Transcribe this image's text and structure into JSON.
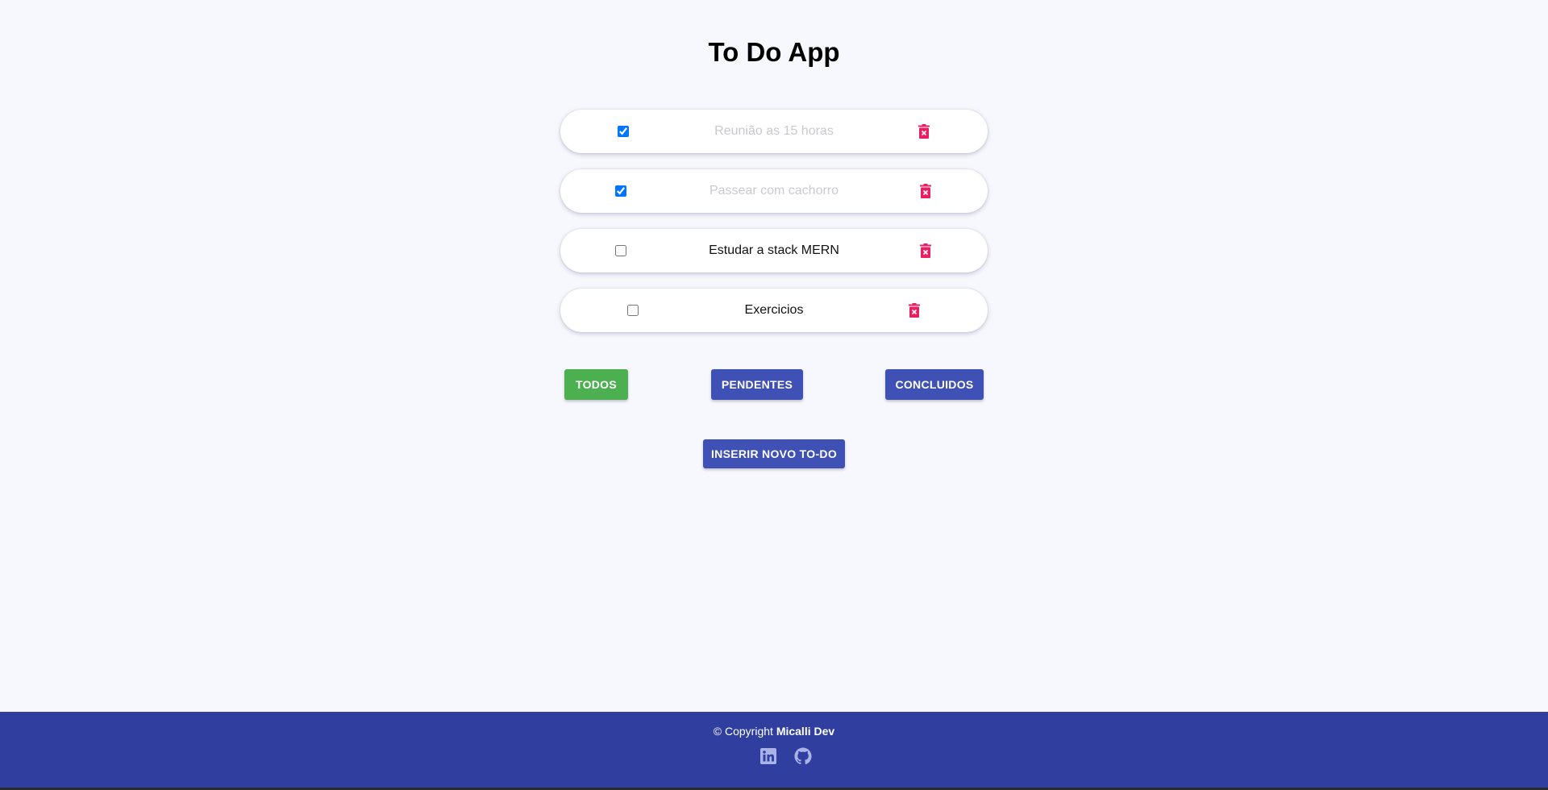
{
  "app": {
    "title": "To Do App"
  },
  "todos": [
    {
      "text": "Reunião as 15 horas",
      "completed": true
    },
    {
      "text": "Passear com cachorro",
      "completed": true
    },
    {
      "text": "Estudar a stack MERN",
      "completed": false
    },
    {
      "text": "Exercicios",
      "completed": false
    }
  ],
  "filters": {
    "all_label": "TODOS",
    "pending_label": "PENDENTES",
    "completed_label": "CONCLUIDOS",
    "active": "TODOS"
  },
  "actions": {
    "add_label": "INSERIR NOVO TO-DO"
  },
  "footer": {
    "copyright_prefix": "© Copyright",
    "author": "Micalli Dev",
    "social_icons": [
      "linkedin-icon",
      "github-icon"
    ]
  },
  "colors": {
    "background": "#f7f8fd",
    "primary": "#3f51b5",
    "active_filter": "#4caf50",
    "footer": "#303f9f",
    "delete_icon": "#e91e63",
    "done_text": "#c9c9cf",
    "checkbox_checked": "#1a73e8"
  }
}
